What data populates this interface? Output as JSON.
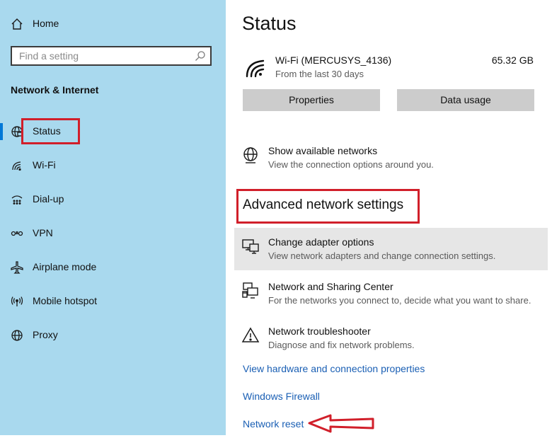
{
  "sidebar": {
    "home_label": "Home",
    "search_placeholder": "Find a setting",
    "section_title": "Network & Internet",
    "items": [
      {
        "label": "Status",
        "icon": "globe-status-icon"
      },
      {
        "label": "Wi-Fi",
        "icon": "wifi-icon"
      },
      {
        "label": "Dial-up",
        "icon": "dialup-icon"
      },
      {
        "label": "VPN",
        "icon": "vpn-icon"
      },
      {
        "label": "Airplane mode",
        "icon": "airplane-icon"
      },
      {
        "label": "Mobile hotspot",
        "icon": "hotspot-icon"
      },
      {
        "label": "Proxy",
        "icon": "globe-icon"
      }
    ],
    "selected_index": 0
  },
  "main": {
    "page_title": "Status",
    "connection": {
      "name": "Wi-Fi (MERCUSYS_4136)",
      "subtitle": "From the last 30 days",
      "usage": "65.32 GB"
    },
    "buttons": {
      "properties": "Properties",
      "data_usage": "Data usage"
    },
    "show_networks": {
      "title": "Show available networks",
      "subtitle": "View the connection options around you."
    },
    "advanced_heading": "Advanced network settings",
    "advanced_items": [
      {
        "title": "Change adapter options",
        "subtitle": "View network adapters and change connection settings."
      },
      {
        "title": "Network and Sharing Center",
        "subtitle": "For the networks you connect to, decide what you want to share."
      },
      {
        "title": "Network troubleshooter",
        "subtitle": "Diagnose and fix network problems."
      }
    ],
    "links": {
      "hardware": "View hardware and connection properties",
      "firewall": "Windows Firewall",
      "reset": "Network reset"
    }
  },
  "colors": {
    "sidebar_bg": "#a9d9ee",
    "accent": "#0078d7",
    "link": "#1a5fb4",
    "annotation_red": "#d11f2a",
    "button_bg": "#cccccc"
  }
}
